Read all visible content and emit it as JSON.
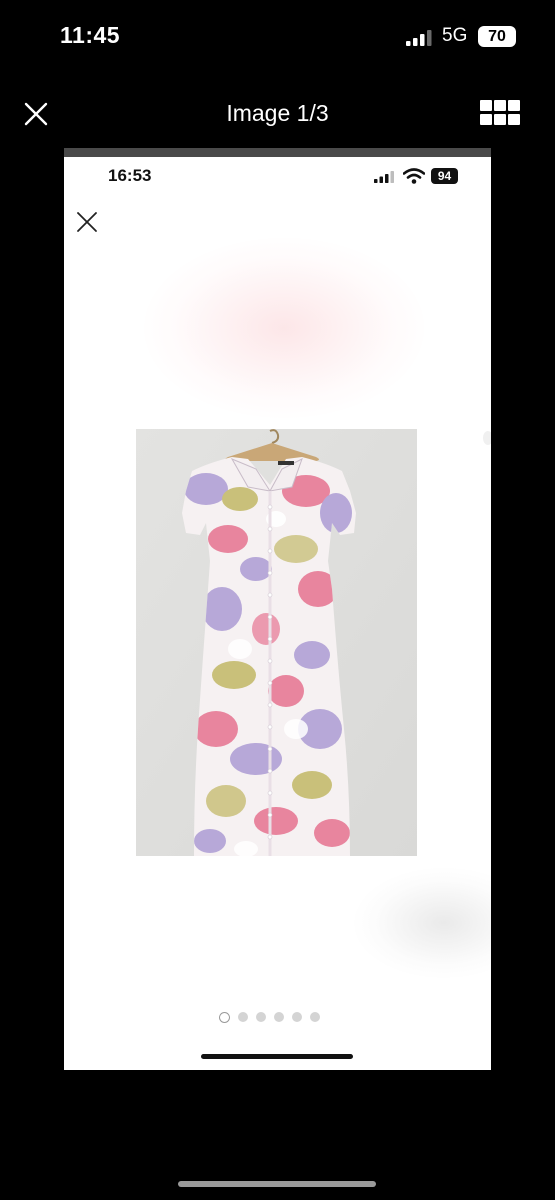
{
  "status_bar": {
    "time": "11:45",
    "network": "5G",
    "battery": "70"
  },
  "viewer": {
    "title": "Image 1/3",
    "close_icon": "close-icon",
    "grid_icon": "grid-view-icon"
  },
  "inner_screen": {
    "status_bar": {
      "time": "16:53",
      "battery": "94"
    },
    "close_icon": "close-icon",
    "product_image": "floral pastel short-sleeve button-front maxi dress on wooden hanger",
    "pagination": {
      "total": 6,
      "active_index": 0
    }
  },
  "colors": {
    "background": "#000000",
    "inner_background": "#ffffff",
    "dress_pink": "#e8859e",
    "dress_lilac": "#b7a8d8",
    "dress_olive": "#c9c07a"
  }
}
